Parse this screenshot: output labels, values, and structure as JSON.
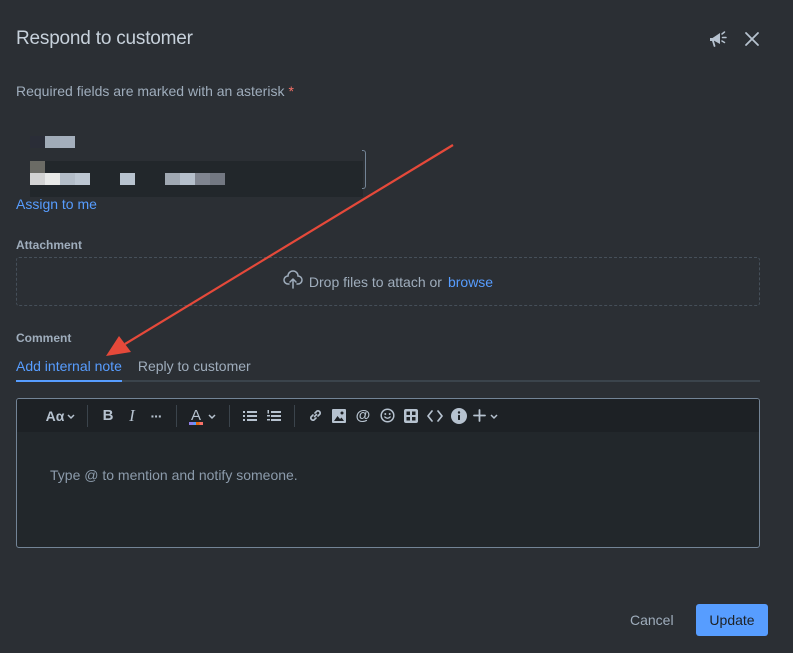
{
  "dialog": {
    "title": "Respond to customer",
    "megaphone_icon": "megaphone-icon",
    "close_icon": "close-icon"
  },
  "form": {
    "required_note": "Required fields are marked with an asterisk",
    "required_asterisk": "*",
    "assignee_field": {
      "label": "[redacted]",
      "value": "[redacted]"
    },
    "assign_to_me": "Assign to me",
    "attachment": {
      "label": "Attachment",
      "icon": "cloud-upload-icon",
      "drop_text": "Drop files to attach or",
      "browse_link": "browse"
    },
    "comment": {
      "label": "Comment",
      "tabs": [
        {
          "label": "Add internal note",
          "active": true
        },
        {
          "label": "Reply to customer",
          "active": false
        }
      ],
      "toolbar": {
        "text_style": "Aα",
        "bold": "B",
        "italic": "I",
        "more": "···",
        "text_color": "A",
        "icons": [
          "text-style-icon",
          "bold-icon",
          "italic-icon",
          "more-formatting-icon",
          "text-color-icon",
          "bullet-list-icon",
          "numbered-list-icon",
          "link-icon",
          "image-icon",
          "mention-icon",
          "emoji-icon",
          "table-icon",
          "code-icon",
          "info-panel-icon",
          "insert-plus-icon"
        ]
      },
      "placeholder": "Type @ to mention and notify someone."
    }
  },
  "footer": {
    "cancel_label": "Cancel",
    "update_label": "Update"
  },
  "annotation": {
    "type": "arrow",
    "color": "#e5493a",
    "points_to": "Add internal note"
  },
  "colors": {
    "background": "#2b2f34",
    "accent": "#579dff",
    "required": "#f87168"
  }
}
